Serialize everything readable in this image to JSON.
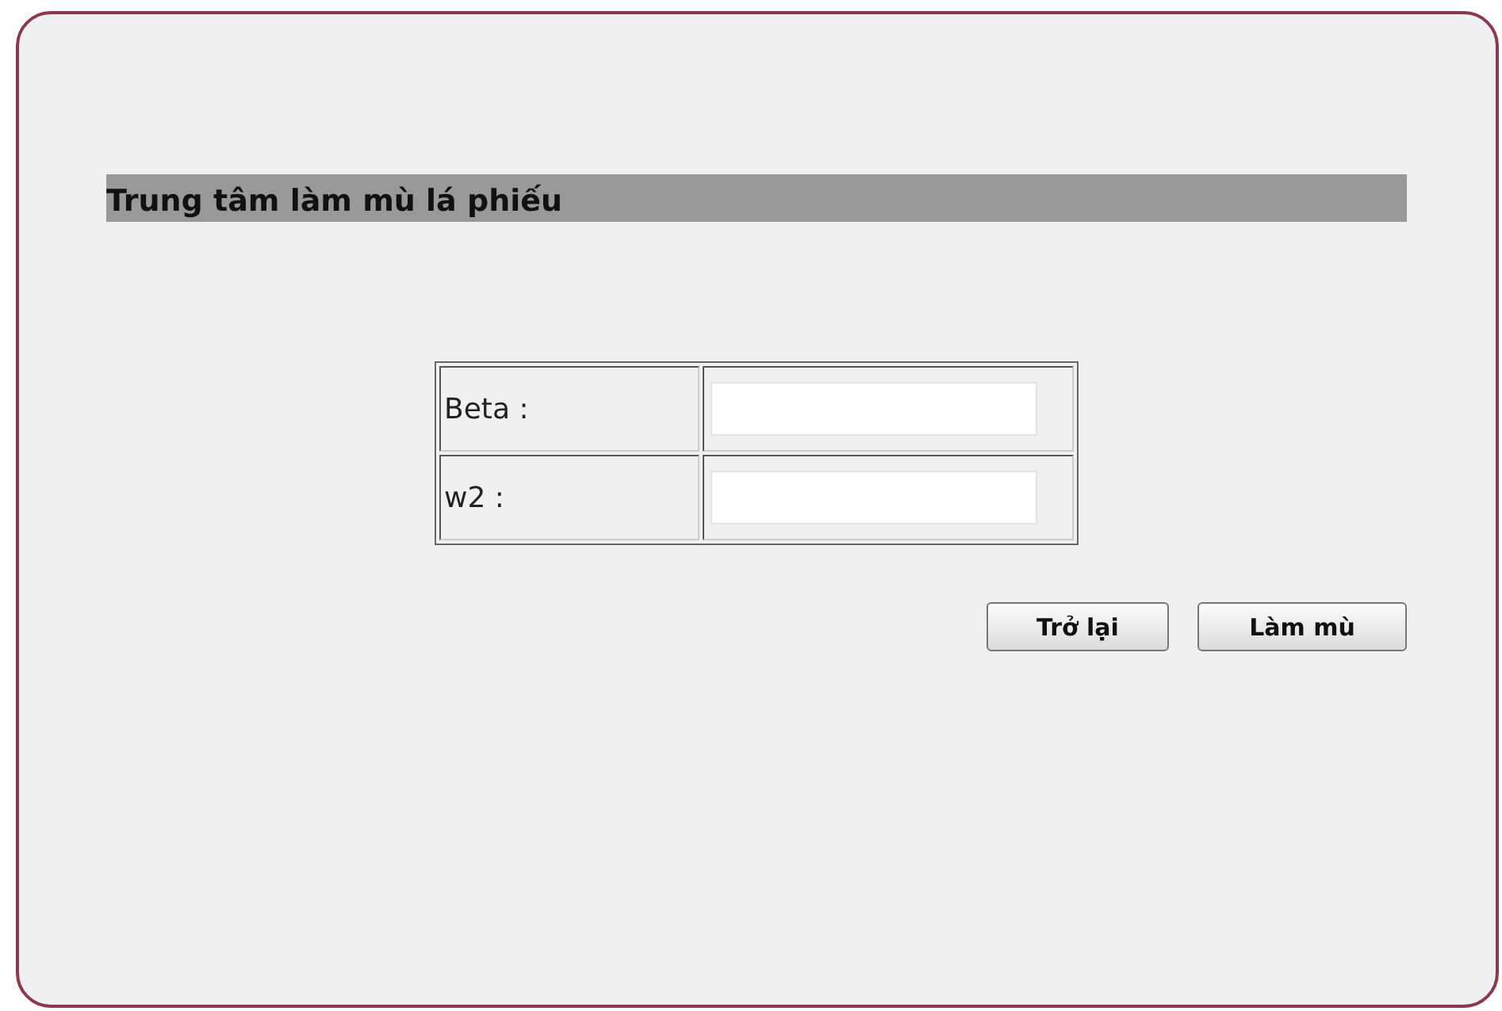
{
  "title": "Trung tâm làm mù lá phiếu",
  "fields": [
    {
      "label": "Beta :"
    },
    {
      "label": "w2 :"
    }
  ],
  "buttons": [
    "Trở lại",
    "Làm mù"
  ]
}
